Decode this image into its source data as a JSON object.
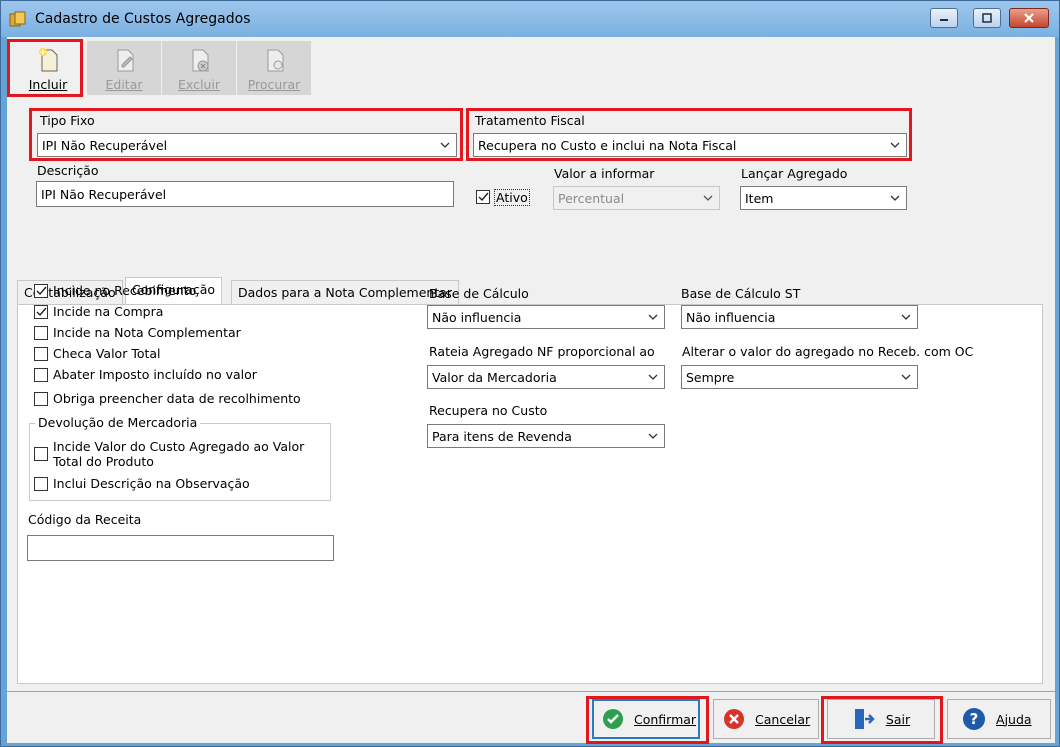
{
  "window": {
    "title": "Cadastro de Custos Agregados"
  },
  "toolbar": {
    "incluir": "Incluir",
    "editar": "Editar",
    "excluir": "Excluir",
    "procurar": "Procurar"
  },
  "form": {
    "tipo_fixo": {
      "label": "Tipo Fixo",
      "value": "IPI Não Recuperável"
    },
    "tratamento_fiscal": {
      "label": "Tratamento Fiscal",
      "value": "Recupera no Custo e inclui na Nota Fiscal"
    },
    "descricao": {
      "label": "Descrição",
      "value": "IPI Não Recuperável"
    },
    "ativo": {
      "label": "Ativo",
      "checked": true
    },
    "valor_a_informar": {
      "label": "Valor a informar",
      "value": "Percentual"
    },
    "lancar_agregado": {
      "label": "Lançar Agregado",
      "value": "Item"
    }
  },
  "tabs": [
    {
      "label": "Contabilização"
    },
    {
      "label": "Configuração"
    },
    {
      "label": "Dados para a Nota Complementar"
    }
  ],
  "config": {
    "checkboxes": [
      {
        "label": "Incide no Recebimento",
        "checked": true
      },
      {
        "label": "Incide na Compra",
        "checked": true
      },
      {
        "label": "Incide na Nota Complementar",
        "checked": false
      },
      {
        "label": "Checa Valor Total",
        "checked": false
      },
      {
        "label": "Abater Imposto incluído no valor",
        "checked": false
      },
      {
        "label": "Obriga preencher data de recolhimento",
        "checked": false
      }
    ],
    "devolucao": {
      "title": "Devolução de Mercadoria",
      "items": [
        {
          "label": "Incide Valor do Custo Agregado ao Valor Total do Produto",
          "line1": "Incide Valor do Custo Agregado ao Valor",
          "line2": "Total do Produto",
          "checked": false
        },
        {
          "label": "Inclui Descrição na Observação",
          "checked": false
        }
      ]
    },
    "codigo_receita": {
      "label": "Código da Receita",
      "value": ""
    },
    "base_calculo": {
      "label": "Base de Cálculo",
      "value": "Não influencia"
    },
    "base_calculo_st": {
      "label": "Base de Cálculo ST",
      "value": "Não influencia"
    },
    "rateia": {
      "label": "Rateia Agregado NF proporcional ao",
      "value": "Valor da Mercadoria"
    },
    "alterar_valor": {
      "label": "Alterar o valor do agregado no Receb. com OC",
      "value": "Sempre"
    },
    "recupera_custo": {
      "label": "Recupera no Custo",
      "value": "Para itens de Revenda"
    }
  },
  "buttons": {
    "confirmar": "Confirmar",
    "cancelar": "Cancelar",
    "sair": "Sair",
    "ajuda": "Ajuda"
  },
  "colors": {
    "highlight": "#e0181e",
    "title_bg": "#7ab1e2",
    "confirm_green": "#2f9e4f",
    "cancel_red": "#d6332b",
    "help_blue": "#1e5aa8"
  }
}
